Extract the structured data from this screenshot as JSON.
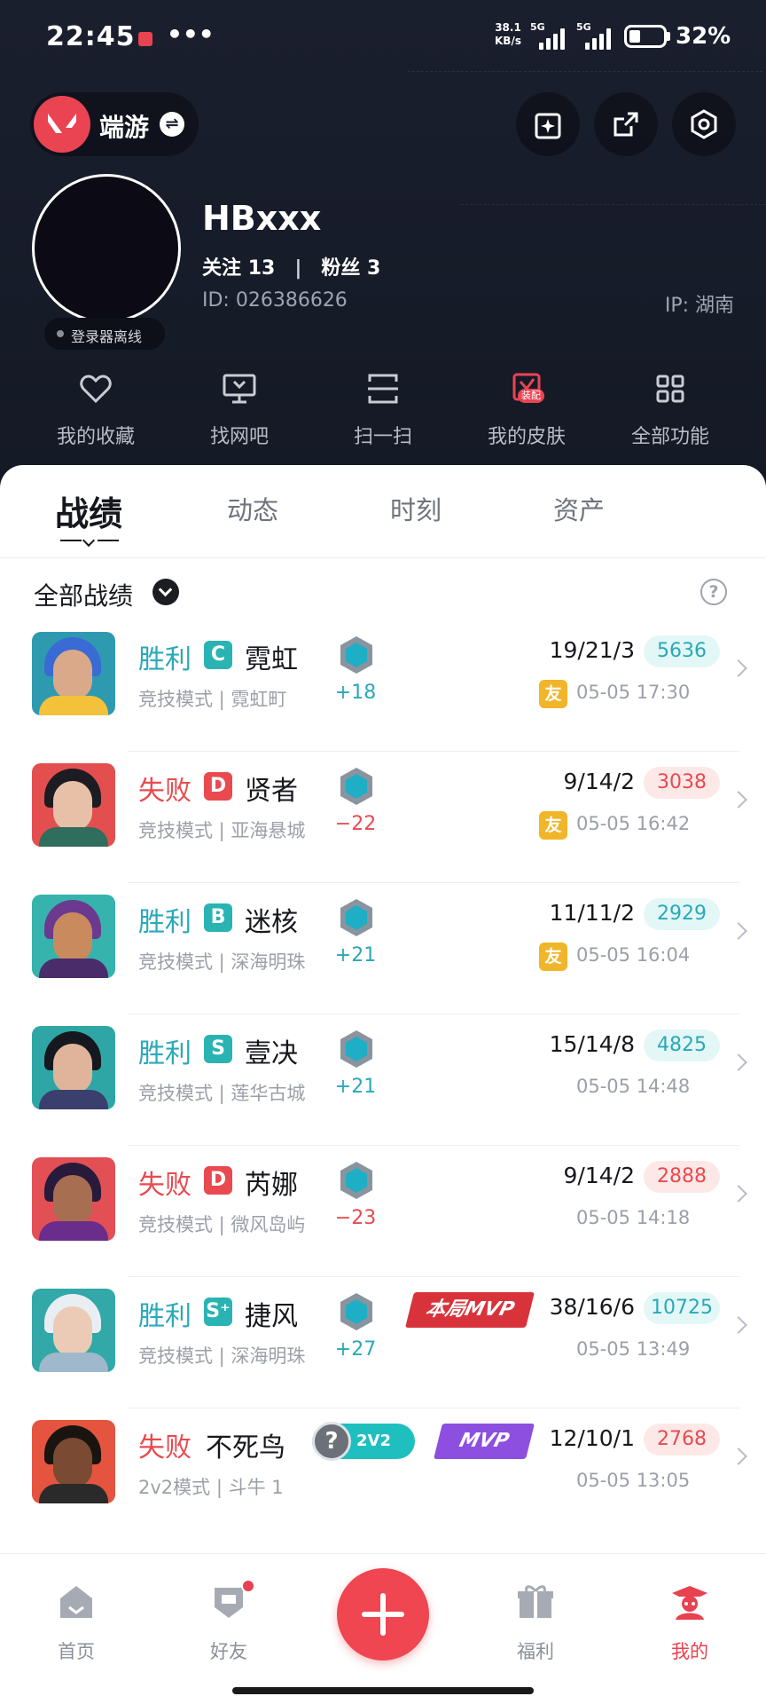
{
  "status_bar": {
    "time": "22:45",
    "dots": "•••",
    "speed_value": "38.1",
    "speed_unit": "KB/s",
    "sim1": "5G",
    "sim2": "5G",
    "battery": "32%"
  },
  "header": {
    "switch_label": "端游",
    "username": "HBxxx",
    "follow_label": "关注",
    "follow_count": "13",
    "fans_label": "粉丝",
    "fans_count": "3",
    "id_text": "ID: 026386626",
    "ip_text": "IP: 湖南",
    "offline_text": "登录器离线"
  },
  "quick_actions": [
    {
      "label": "我的收藏",
      "icon": "heart-icon"
    },
    {
      "label": "找网吧",
      "icon": "monitor-icon"
    },
    {
      "label": "扫一扫",
      "icon": "scan-icon"
    },
    {
      "label": "我的皮肤",
      "icon": "skin-icon",
      "badge": "装配"
    },
    {
      "label": "全部功能",
      "icon": "grid-icon"
    }
  ],
  "tabs": [
    {
      "label": "战绩",
      "active": true
    },
    {
      "label": "动态",
      "active": false
    },
    {
      "label": "时刻",
      "active": false
    },
    {
      "label": "资产",
      "active": false
    }
  ],
  "filter": {
    "label": "全部战绩",
    "help": "?"
  },
  "colors": {
    "win": "#2aa9b8",
    "loss": "#e84a4f",
    "accent": "#ef4651",
    "win_bg": "#e3f7f7",
    "loss_bg": "#fde8e8"
  },
  "matches": [
    {
      "result": "胜利",
      "rank": "C",
      "agent": "霓虹",
      "mode": "竞技模式 | 霓虹町",
      "rr": "+18",
      "kda": "19/21/3",
      "score": "5636",
      "friend": "友",
      "time": "05-05 17:30"
    },
    {
      "result": "失败",
      "rank": "D",
      "agent": "贤者",
      "mode": "竞技模式 | 亚海悬城",
      "rr": "−22",
      "kda": "9/14/2",
      "score": "3038",
      "friend": "友",
      "time": "05-05 16:42"
    },
    {
      "result": "胜利",
      "rank": "B",
      "agent": "迷核",
      "mode": "竞技模式 | 深海明珠",
      "rr": "+21",
      "kda": "11/11/2",
      "score": "2929",
      "friend": "友",
      "time": "05-05 16:04"
    },
    {
      "result": "胜利",
      "rank": "S",
      "agent": "壹决",
      "mode": "竞技模式 | 莲华古城",
      "rr": "+21",
      "kda": "15/14/8",
      "score": "4825",
      "time": "05-05 14:48"
    },
    {
      "result": "失败",
      "rank": "D",
      "agent": "芮娜",
      "mode": "竞技模式 | 微风岛屿",
      "rr": "−23",
      "kda": "9/14/2",
      "score": "2888",
      "time": "05-05 14:18"
    },
    {
      "result": "胜利",
      "rank": "S⁺",
      "agent": "捷风",
      "mode": "竞技模式 | 深海明珠",
      "rr": "+27",
      "mvp": "本局MVP",
      "kda": "38/16/6",
      "score": "10725",
      "time": "05-05 13:49"
    },
    {
      "result": "失败",
      "agent": "不死鸟",
      "mode": "2v2模式 | 斗牛 1",
      "badge_2v2": "2V2",
      "badge_2v2_q": "?",
      "mvp": "MVP",
      "kda": "12/10/1",
      "score": "2768",
      "time": "05-05 13:05"
    }
  ],
  "nav": [
    {
      "label": "首页",
      "icon": "home-icon"
    },
    {
      "label": "好友",
      "icon": "friends-icon"
    },
    {
      "label": "福利",
      "icon": "gift-icon"
    },
    {
      "label": "我的",
      "icon": "profile-icon",
      "active": true
    }
  ]
}
